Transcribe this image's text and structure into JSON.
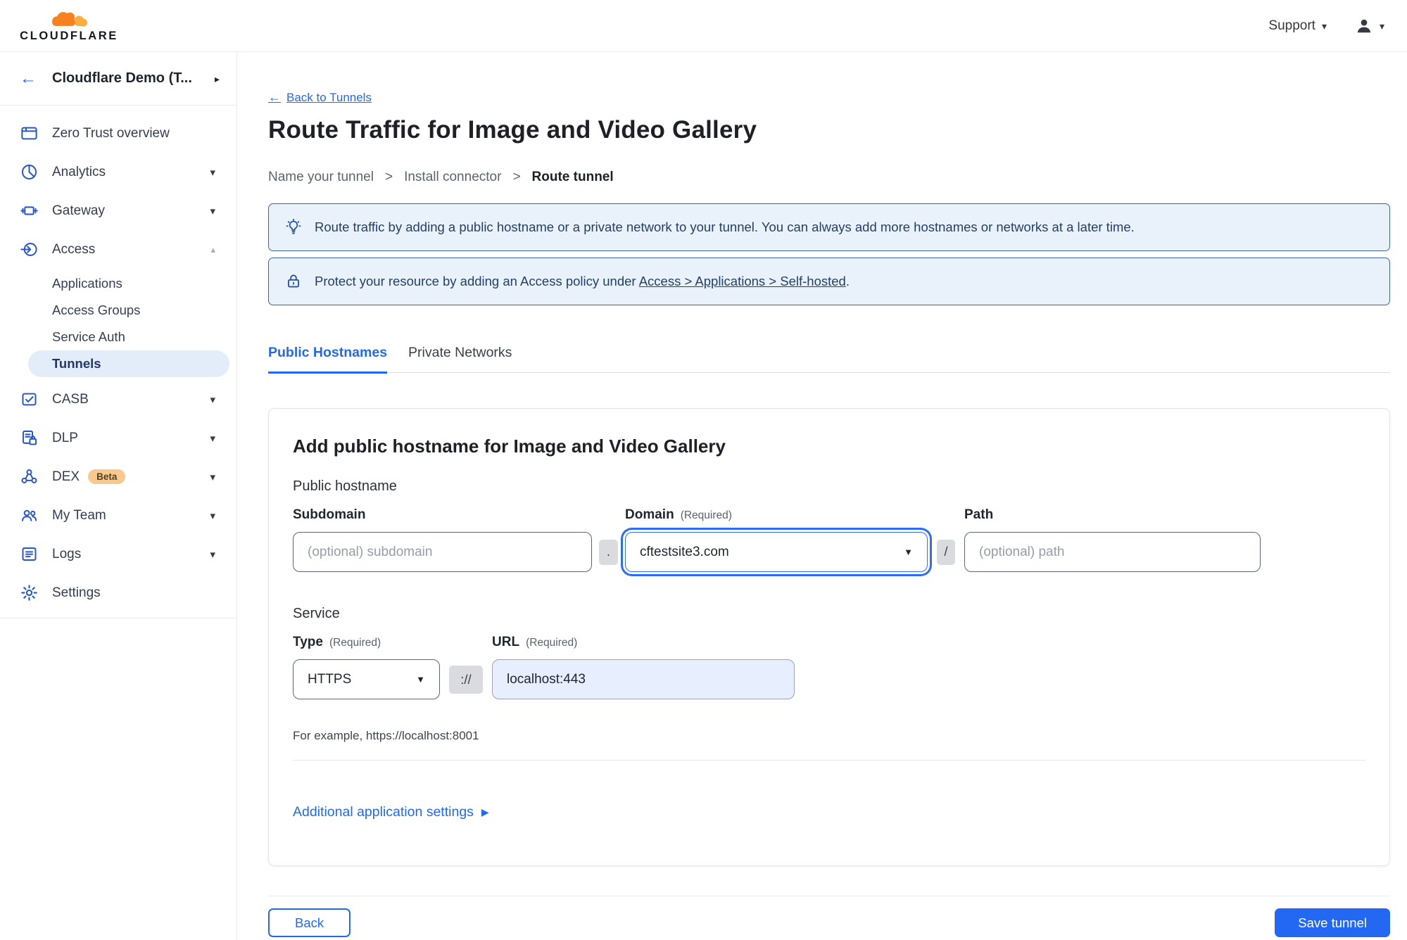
{
  "topbar": {
    "brand": "CLOUDFLARE",
    "support_label": "Support"
  },
  "sidebar": {
    "account": "Cloudflare Demo (T...",
    "items": [
      {
        "label": "Zero Trust overview"
      },
      {
        "label": "Analytics"
      },
      {
        "label": "Gateway"
      },
      {
        "label": "Access"
      },
      {
        "label": "CASB"
      },
      {
        "label": "DLP"
      },
      {
        "label": "DEX",
        "badge": "Beta"
      },
      {
        "label": "My Team"
      },
      {
        "label": "Logs"
      },
      {
        "label": "Settings"
      }
    ],
    "access_children": [
      {
        "label": "Applications"
      },
      {
        "label": "Access Groups"
      },
      {
        "label": "Service Auth"
      },
      {
        "label": "Tunnels"
      }
    ]
  },
  "header": {
    "back_link": "Back to Tunnels",
    "title": "Route Traffic for Image and Video Gallery",
    "breadcrumb": {
      "step1": "Name your tunnel",
      "sep": ">",
      "step2": "Install connector",
      "step3": "Route tunnel"
    }
  },
  "banners": {
    "info_text": "Route traffic by adding a public hostname or a private network to your tunnel. You can always add more hostnames or networks at a later time.",
    "protect_prefix": "Protect your resource by adding an Access policy under",
    "protect_link": "Access > Applications > Self-hosted",
    "protect_suffix": "."
  },
  "tabs": {
    "public": "Public Hostnames",
    "private": "Private Networks"
  },
  "form": {
    "heading": "Add public hostname for Image and Video Gallery",
    "public_hostname_label": "Public hostname",
    "subdomain_label": "Subdomain",
    "subdomain_placeholder": "(optional) subdomain",
    "dot_separator": ".",
    "domain_label": "Domain",
    "required": "(Required)",
    "domain_value": "cftestsite3.com",
    "slash_separator": "/",
    "path_label": "Path",
    "path_placeholder": "(optional) path",
    "service_label": "Service",
    "type_label": "Type",
    "type_value": "HTTPS",
    "scheme_separator": "://",
    "url_label": "URL",
    "url_value": "localhost:443",
    "example_hint": "For example, https://localhost:8001",
    "additional_settings": "Additional application settings"
  },
  "footer": {
    "back": "Back",
    "save": "Save tunnel"
  },
  "icons": {
    "back_arrow": "←",
    "chevron_right": "▸",
    "chevron_down": "▾",
    "chevron_up": "▴",
    "select_caret": "▼",
    "disclosure_triangle": "▶"
  },
  "colors": {
    "accent_blue": "#2268f3",
    "sidebar_icon_blue": "#2b59c3",
    "active_item_text": "#23366b",
    "active_item_bg": "#e3edfa",
    "banner_bg": "#e9f1fb",
    "banner_border": "#3c64a4",
    "banner_text": "#243f66",
    "logo_orange": "#f6821f",
    "logo_orange_light": "#fbad41",
    "beta_badge_bg": "#f8c98e",
    "url_input_bg": "#e7effe"
  }
}
